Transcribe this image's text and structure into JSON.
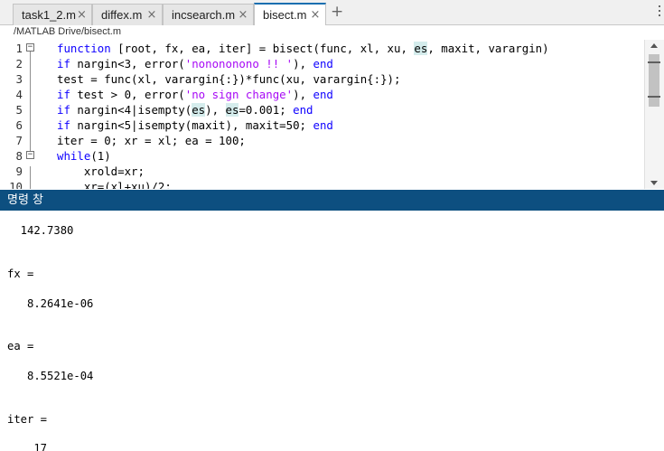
{
  "tabs": [
    {
      "label": "task1_2.m",
      "close": "×"
    },
    {
      "label": "diffex.m",
      "close": "×"
    },
    {
      "label": "incsearch.m",
      "close": "×"
    },
    {
      "label": "bisect.m",
      "close": "×"
    }
  ],
  "new_tab": "+",
  "path": "/MATLAB Drive/bisect.m",
  "editor": {
    "line_numbers": [
      "1",
      "2",
      "3",
      "4",
      "5",
      "6",
      "7",
      "8",
      "9",
      "10"
    ],
    "fold_glyph": "−",
    "lines": [
      [
        {
          "t": "function",
          "c": "kw"
        },
        {
          "t": " [root, fx, ea, iter] = bisect(func, xl, xu, "
        },
        {
          "t": "es",
          "c": "hl"
        },
        {
          "t": ", maxit, varargin)"
        }
      ],
      [
        {
          "t": "if",
          "c": "kw"
        },
        {
          "t": " nargin<3, error("
        },
        {
          "t": "'nonononono !! '",
          "c": "str"
        },
        {
          "t": "), "
        },
        {
          "t": "end",
          "c": "kw"
        }
      ],
      [
        {
          "t": "test = func(xl, varargin{:})*func(xu, varargin{:});"
        }
      ],
      [
        {
          "t": "if",
          "c": "kw"
        },
        {
          "t": " test > 0, error("
        },
        {
          "t": "'no sign change'",
          "c": "str"
        },
        {
          "t": "), "
        },
        {
          "t": "end",
          "c": "kw"
        }
      ],
      [
        {
          "t": "if",
          "c": "kw"
        },
        {
          "t": " nargin<4|isempty("
        },
        {
          "t": "es",
          "c": "hl"
        },
        {
          "t": "), "
        },
        {
          "t": "es",
          "c": "hl"
        },
        {
          "t": "=0.001; "
        },
        {
          "t": "end",
          "c": "kw"
        }
      ],
      [
        {
          "t": "if",
          "c": "kw"
        },
        {
          "t": " nargin<5|isempty(maxit), maxit=50; "
        },
        {
          "t": "end",
          "c": "kw"
        }
      ],
      [
        {
          "t": "iter = 0; xr = xl; ea = 100;"
        }
      ],
      [
        {
          "t": "while",
          "c": "kw"
        },
        {
          "t": "(1)"
        }
      ],
      [
        {
          "t": "    xrold=xr;"
        }
      ],
      [
        {
          "t": "    xr=(xl+xu)/2;"
        }
      ]
    ]
  },
  "command_window": {
    "title": "명령 창",
    "output": [
      "  142.7380",
      "fx =",
      "   8.2641e-06",
      "ea =",
      "   8.5521e-04",
      "iter =",
      "    17"
    ]
  }
}
